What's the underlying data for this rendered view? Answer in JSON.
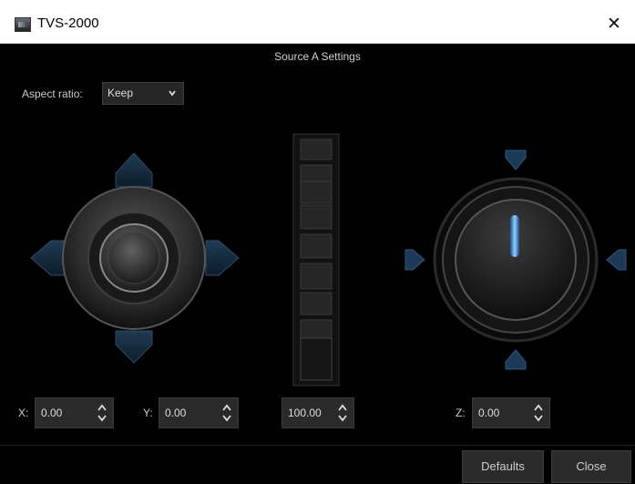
{
  "window": {
    "title": "TVS-2000",
    "close_glyph": "✕"
  },
  "dialog": {
    "heading": "Source A Settings",
    "aspect_ratio": {
      "label": "Aspect ratio:",
      "value": "Keep"
    },
    "fields": {
      "x": {
        "label": "X:",
        "value": "0.00"
      },
      "y": {
        "label": "Y:",
        "value": "0.00"
      },
      "zoom": {
        "value": "100.00"
      },
      "z": {
        "label": "Z:",
        "value": "0.00"
      }
    },
    "buttons": {
      "defaults": "Defaults",
      "close": "Close"
    }
  },
  "colors": {
    "accent": "#4fa8ff",
    "background": "#000000",
    "control": "#2a2a2a"
  },
  "icons": [
    "app-icon",
    "close-icon",
    "chevron-down-icon",
    "spin-arrows-icon",
    "arrow-up-icon",
    "arrow-down-icon",
    "arrow-left-icon",
    "arrow-right-icon"
  ]
}
